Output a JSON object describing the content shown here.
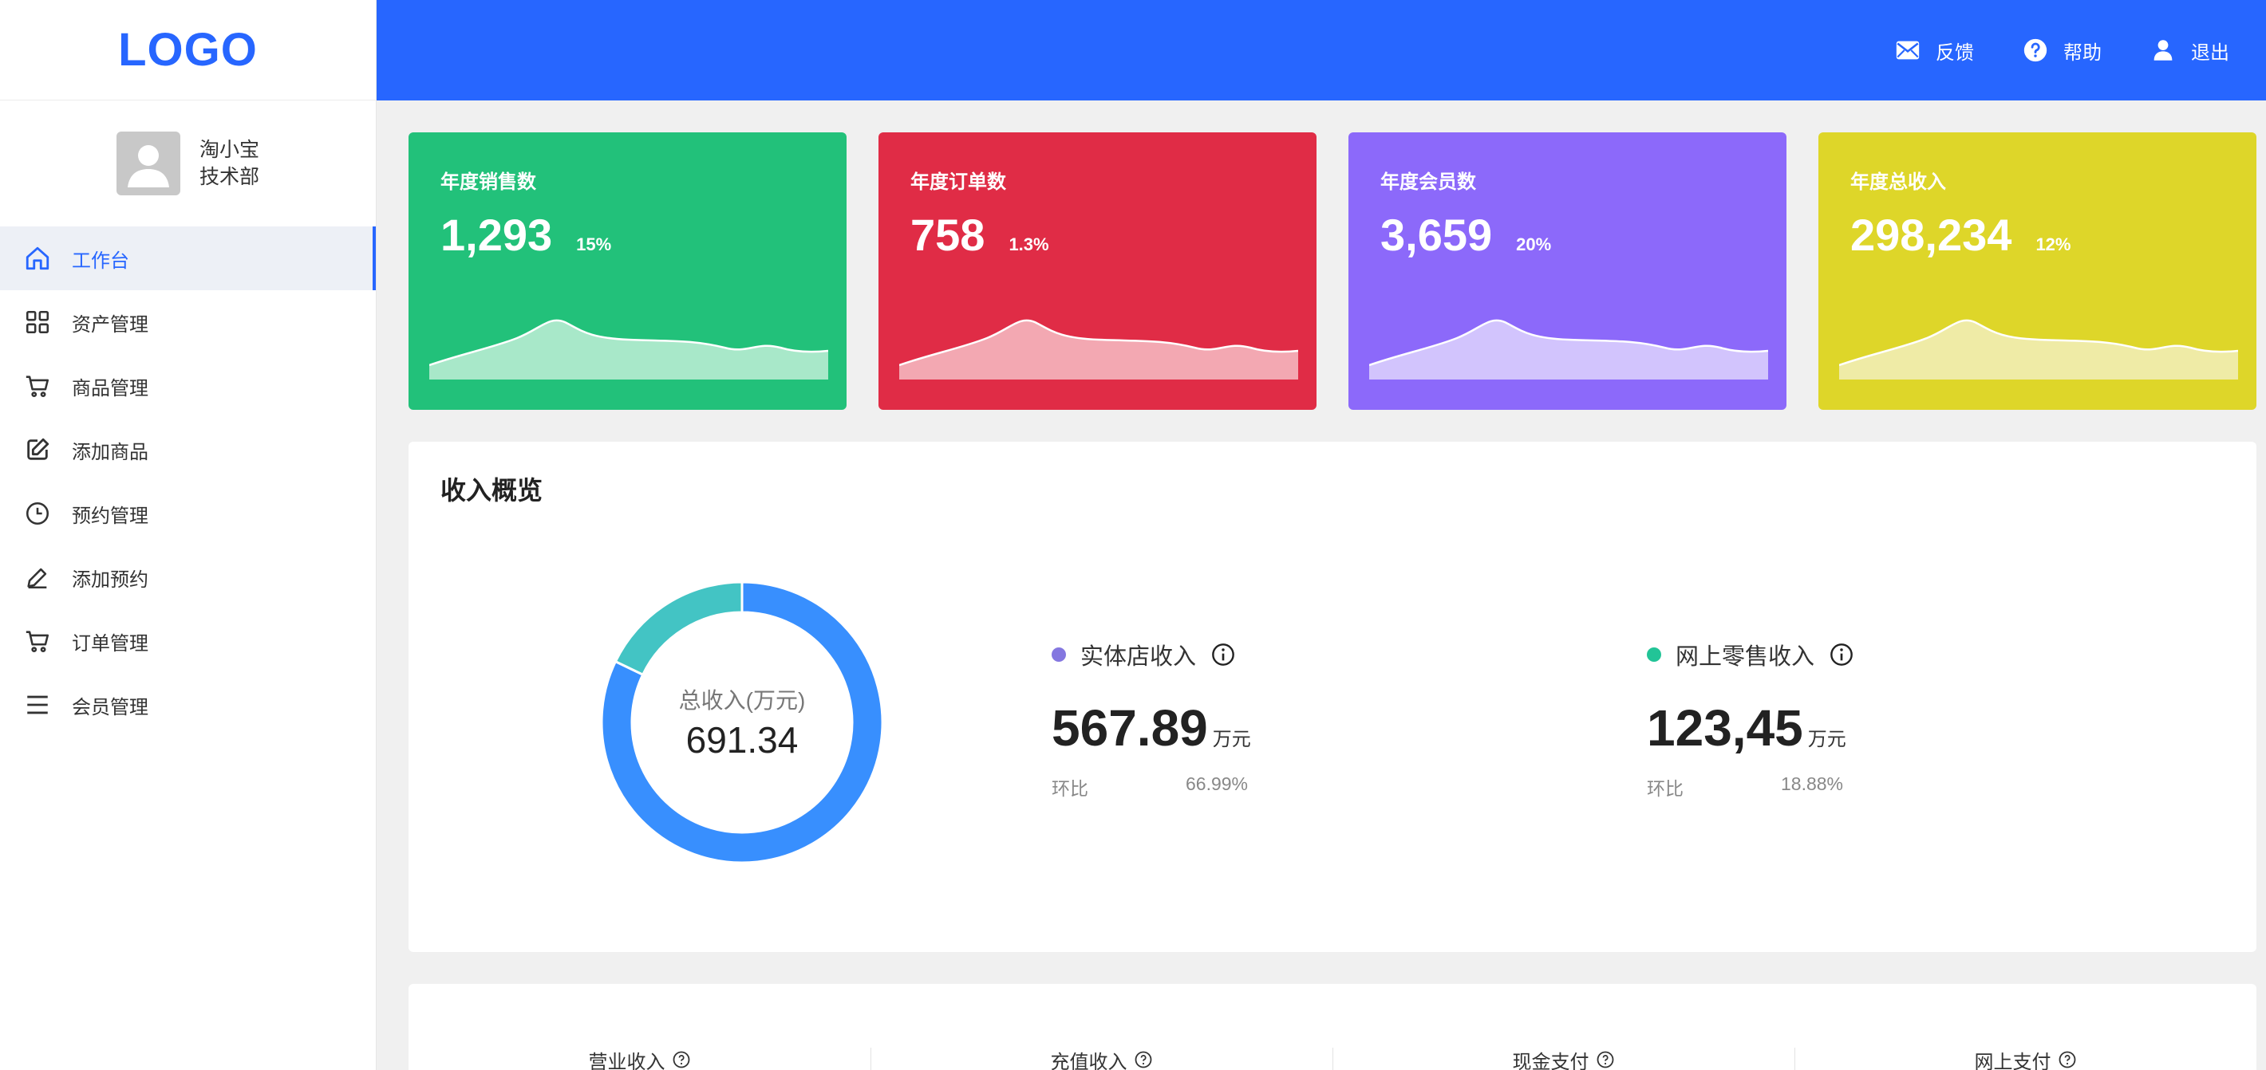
{
  "brand": {
    "logo": "LOGO",
    "accent": "#2766ff"
  },
  "user": {
    "name": "淘小宝",
    "department": "技术部"
  },
  "sidebar": {
    "items": [
      {
        "label": "工作台",
        "icon": "home-icon",
        "active": true
      },
      {
        "label": "资产管理",
        "icon": "grid-icon",
        "active": false
      },
      {
        "label": "商品管理",
        "icon": "cart-icon",
        "active": false
      },
      {
        "label": "添加商品",
        "icon": "edit-square-icon",
        "active": false
      },
      {
        "label": "预约管理",
        "icon": "clock-icon",
        "active": false
      },
      {
        "label": "添加预约",
        "icon": "pencil-icon",
        "active": false
      },
      {
        "label": "订单管理",
        "icon": "cart-icon",
        "active": false
      },
      {
        "label": "会员管理",
        "icon": "menu-lines-icon",
        "active": false
      }
    ]
  },
  "header": {
    "actions": [
      {
        "label": "反馈",
        "icon": "mail-icon"
      },
      {
        "label": "帮助",
        "icon": "help-circle-icon"
      },
      {
        "label": "退出",
        "icon": "user-icon"
      }
    ]
  },
  "cards": [
    {
      "title": "年度销售数",
      "value": "1,293",
      "percent": "15%",
      "color": "#22c17a",
      "wave_color": "#a8e8c9"
    },
    {
      "title": "年度订单数",
      "value": "758",
      "percent": "1.3%",
      "color": "#e02c46",
      "wave_color": "#f3a8b2"
    },
    {
      "title": "年度会员数",
      "value": "3,659",
      "percent": "20%",
      "color": "#8c69fa",
      "wave_color": "#d2c4fd"
    },
    {
      "title": "年度总收入",
      "value": "298,234",
      "percent": "12%",
      "color": "#ded629",
      "wave_color": "#efeba6"
    }
  ],
  "overview": {
    "title": "收入概览",
    "donut": {
      "label": "总收入(万元)",
      "total": "691.34",
      "segments": [
        {
          "name": "实体店收入",
          "value": 567.89,
          "color": "#388ffe"
        },
        {
          "name": "网上零售收入",
          "value": 123.45,
          "color": "#43c4c4"
        }
      ]
    },
    "stats": [
      {
        "label": "实体店收入",
        "dot_color": "#8477e0",
        "value": "567.89",
        "unit": "万元",
        "compare_label": "环比",
        "compare_value": "66.99%"
      },
      {
        "label": "网上零售收入",
        "dot_color": "#22c497",
        "value": "123,45",
        "unit": "万元",
        "compare_label": "环比",
        "compare_value": "18.88%"
      }
    ]
  },
  "metrics": [
    {
      "label": "营业收入"
    },
    {
      "label": "充值收入"
    },
    {
      "label": "现金支付"
    },
    {
      "label": "网上支付"
    }
  ]
}
